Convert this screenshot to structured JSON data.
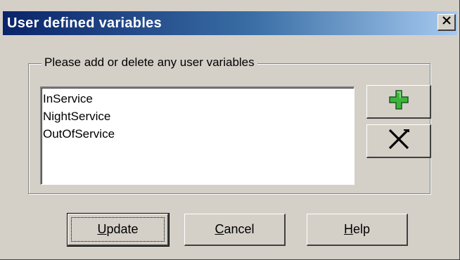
{
  "dialog": {
    "title": "User defined variables",
    "close_icon": "close-x-icon"
  },
  "group": {
    "legend": "Please add or delete any user variables"
  },
  "variables": [
    "InService",
    "NightService",
    "OutOfService"
  ],
  "side_buttons": {
    "add_icon": "green-plus-icon",
    "delete_icon": "cross-delete-icon"
  },
  "buttons": {
    "update": {
      "label": "Update"
    },
    "cancel": {
      "label": "Cancel"
    },
    "help": {
      "label": "Help"
    }
  },
  "colors": {
    "title_start": "#0a246a",
    "title_end": "#a6caf0",
    "face": "#d4d0c8",
    "plus_green": "#3cb43c"
  }
}
